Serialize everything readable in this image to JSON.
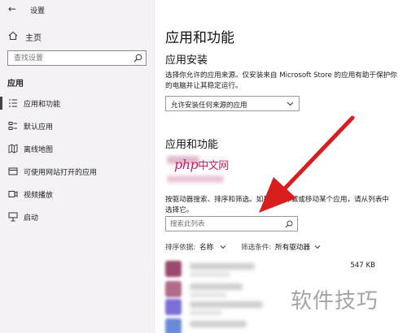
{
  "window": {
    "title": "设置"
  },
  "sidebar": {
    "home_label": "主页",
    "search_placeholder": "查找设置",
    "section_heading": "应用",
    "items": [
      {
        "label": "应用和功能",
        "icon": "apps-list-icon",
        "active": true
      },
      {
        "label": "默认应用",
        "icon": "default-apps-icon",
        "active": false
      },
      {
        "label": "离线地图",
        "icon": "offline-maps-icon",
        "active": false
      },
      {
        "label": "可使用网站打开的应用",
        "icon": "apps-for-websites-icon",
        "active": false
      },
      {
        "label": "视频播放",
        "icon": "video-playback-icon",
        "active": false
      },
      {
        "label": "启动",
        "icon": "startup-icon",
        "active": false
      }
    ]
  },
  "main": {
    "title": "应用和功能",
    "install": {
      "heading": "应用安装",
      "description": "选择你允许的应用来源。仅安装来自 Microsoft Store 的应用有助于保护你的电脑并让其稳定运行。",
      "dropdown_value": "允许安装任何来源的应用"
    },
    "apps": {
      "heading": "应用和功能",
      "search_description": "按驱动器搜索、排序和筛选。如果你想卸载或移动某个应用，请从列表中选择它。",
      "search_placeholder": "搜索此列表",
      "sort_label": "排序依据:",
      "sort_value": "名称",
      "filter_label": "筛选条件:",
      "filter_value": "所有驱动器",
      "rows": [
        {
          "size": "547 KB",
          "icon_color": "#9b4a6e"
        },
        {
          "size": "",
          "icon_color": "#b06a8a"
        },
        {
          "size": "",
          "icon_color": "#7c6fd6"
        },
        {
          "size": "",
          "icon_color": "#6b8ad6"
        }
      ]
    }
  },
  "overlays": {
    "logo_text_latin": "php",
    "logo_text_cn": "中文网",
    "watermark": "软件技巧",
    "arrow_color": "#d81e1e"
  }
}
